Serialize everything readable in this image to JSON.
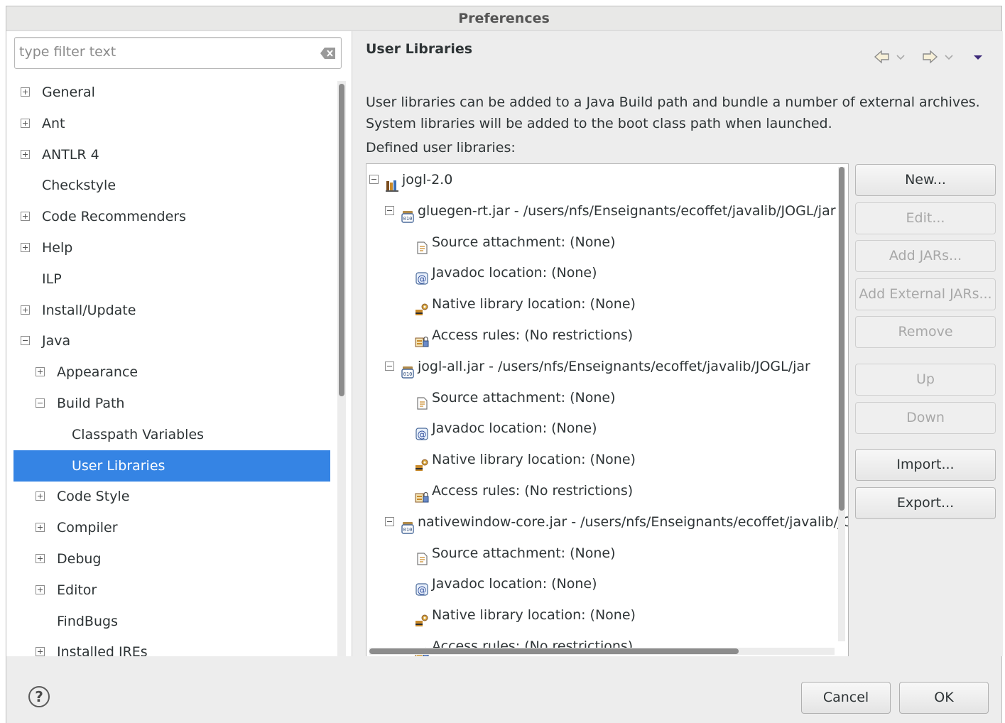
{
  "window": {
    "title": "Preferences"
  },
  "filter": {
    "placeholder": "type filter text"
  },
  "nav_tree": [
    {
      "label": "General",
      "toggle": "plus",
      "level": 0
    },
    {
      "label": "Ant",
      "toggle": "plus",
      "level": 0
    },
    {
      "label": "ANTLR 4",
      "toggle": "plus",
      "level": 0
    },
    {
      "label": "Checkstyle",
      "toggle": "none",
      "level": 0
    },
    {
      "label": "Code Recommenders",
      "toggle": "plus",
      "level": 0
    },
    {
      "label": "Help",
      "toggle": "plus",
      "level": 0
    },
    {
      "label": "ILP",
      "toggle": "none",
      "level": 0
    },
    {
      "label": "Install/Update",
      "toggle": "plus",
      "level": 0
    },
    {
      "label": "Java",
      "toggle": "minus",
      "level": 0
    },
    {
      "label": "Appearance",
      "toggle": "plus",
      "level": 1
    },
    {
      "label": "Build Path",
      "toggle": "minus",
      "level": 1
    },
    {
      "label": "Classpath Variables",
      "toggle": "none",
      "level": 2
    },
    {
      "label": "User Libraries",
      "toggle": "none",
      "level": 2,
      "selected": true
    },
    {
      "label": "Code Style",
      "toggle": "plus",
      "level": 1
    },
    {
      "label": "Compiler",
      "toggle": "plus",
      "level": 1
    },
    {
      "label": "Debug",
      "toggle": "plus",
      "level": 1
    },
    {
      "label": "Editor",
      "toggle": "plus",
      "level": 1
    },
    {
      "label": "FindBugs",
      "toggle": "none",
      "level": 1
    },
    {
      "label": "Installed JREs",
      "toggle": "plus",
      "level": 1
    }
  ],
  "page": {
    "title": "User Libraries",
    "description_line1": "User libraries can be added to a Java Build path and bundle a number of external archives.",
    "description_line2": "System libraries will be added to the boot class path when launched.",
    "defined_label": "Defined user libraries:"
  },
  "libraries": [
    {
      "label": "jogl-2.0",
      "kind": "library",
      "level": 0
    },
    {
      "label": "gluegen-rt.jar - /users/nfs/Enseignants/ecoffet/javalib/JOGL/jar",
      "kind": "jar",
      "level": 1
    },
    {
      "label": "Source attachment: (None)",
      "kind": "source",
      "level": 2
    },
    {
      "label": "Javadoc location: (None)",
      "kind": "javadoc",
      "level": 2
    },
    {
      "label": "Native library location: (None)",
      "kind": "native",
      "level": 2
    },
    {
      "label": "Access rules: (No restrictions)",
      "kind": "access",
      "level": 2
    },
    {
      "label": "jogl-all.jar - /users/nfs/Enseignants/ecoffet/javalib/JOGL/jar",
      "kind": "jar",
      "level": 1
    },
    {
      "label": "Source attachment: (None)",
      "kind": "source",
      "level": 2
    },
    {
      "label": "Javadoc location: (None)",
      "kind": "javadoc",
      "level": 2
    },
    {
      "label": "Native library location: (None)",
      "kind": "native",
      "level": 2
    },
    {
      "label": "Access rules: (No restrictions)",
      "kind": "access",
      "level": 2
    },
    {
      "label": "nativewindow-core.jar - /users/nfs/Enseignants/ecoffet/javalib/JOGL/jar",
      "kind": "jar",
      "level": 1
    },
    {
      "label": "Source attachment: (None)",
      "kind": "source",
      "level": 2
    },
    {
      "label": "Javadoc location: (None)",
      "kind": "javadoc",
      "level": 2
    },
    {
      "label": "Native library location: (None)",
      "kind": "native",
      "level": 2
    },
    {
      "label": "Access rules: (No restrictions)",
      "kind": "access",
      "level": 2
    }
  ],
  "buttons": {
    "new": "New...",
    "edit": "Edit...",
    "add_jars": "Add JARs...",
    "add_external_jars": "Add External JARs...",
    "remove": "Remove",
    "up": "Up",
    "down": "Down",
    "import": "Import...",
    "export": "Export..."
  },
  "footer": {
    "help": "?",
    "cancel": "Cancel",
    "ok": "OK"
  },
  "colors": {
    "selection": "#3584e4",
    "icon_accent": "#8a5a2b"
  }
}
